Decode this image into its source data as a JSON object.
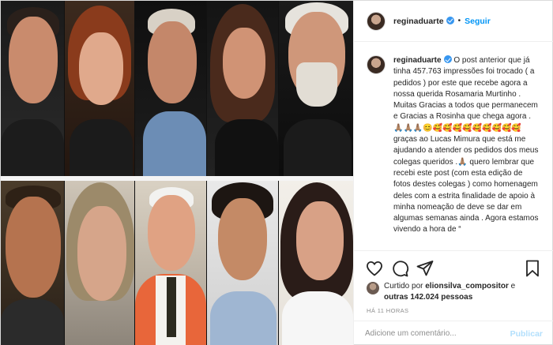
{
  "header": {
    "username": "reginaduarte",
    "separator": "•",
    "follow_label": "Seguir"
  },
  "caption": {
    "username": "reginaduarte",
    "text": "O post anterior que já tinha 457.763 impressões foi trocado ( a pedidos ) por este que recebe agora a nossa querida Rosamaria Murtinho . Muitas Gracias a todos que permanecem e Gracias a Rosinha que chega agora . 🙏🏽🙏🏽🙏🏽😊🥰🥰🥰🥰🥰🥰🥰🥰🥰graças ao Lucas Mimura que está me ajudando a atender os pedidos dos meus colegas queridos .🙏🏽 quero lembrar que recebi este post (com esta edição de fotos destes colegas ) como homenagem deles com a estrita finalidade de apoio à minha nomeação de deve se dar em algumas semanas ainda . Agora estamos vivendo a hora de “"
  },
  "likes": {
    "prefix": "Curtido por",
    "user": "elionsilva_compositor",
    "middle": "e",
    "count": "outras 142.024 pessoas"
  },
  "timestamp": "HÁ 11 HORAS",
  "comment": {
    "placeholder": "Adicione um comentário...",
    "publish_label": "Publicar"
  },
  "icons": [
    "heart-icon",
    "comment-icon",
    "share-icon",
    "bookmark-icon",
    "verified-badge-icon"
  ],
  "colors": {
    "link_blue": "#0095f6",
    "verified_blue": "#3897f0",
    "publish_disabled": "#b2dffc",
    "muted": "#8e8e8e",
    "border": "#dbdbdb"
  }
}
